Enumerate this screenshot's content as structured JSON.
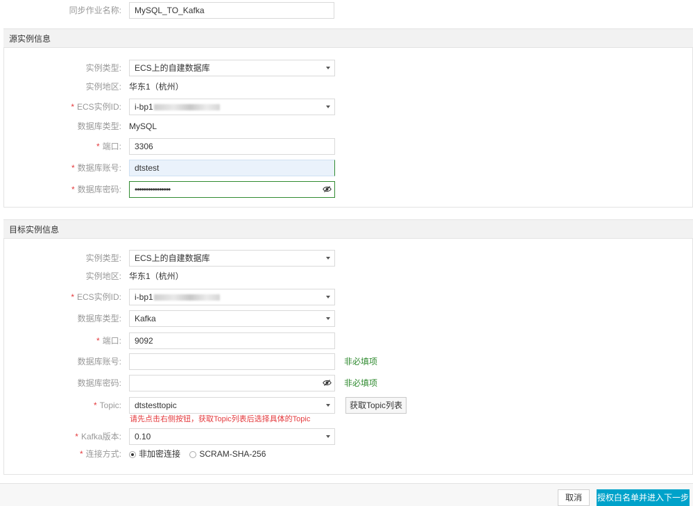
{
  "top": {
    "job_name_label": "同步作业名称:",
    "job_name_value": "MySQL_TO_Kafka"
  },
  "source": {
    "header": "源实例信息",
    "instance_type_label": "实例类型:",
    "instance_type_value": "ECS上的自建数据库",
    "region_label": "实例地区:",
    "region_value": "华东1（杭州）",
    "ecs_id_label": "ECS实例ID:",
    "ecs_id_value": "i-bp1",
    "db_type_label": "数据库类型:",
    "db_type_value": "MySQL",
    "port_label": "端口:",
    "port_value": "3306",
    "account_label": "数据库账号:",
    "account_value": "dtstest",
    "password_label": "数据库密码:",
    "password_value": "••••••••••••••••"
  },
  "target": {
    "header": "目标实例信息",
    "instance_type_label": "实例类型:",
    "instance_type_value": "ECS上的自建数据库",
    "region_label": "实例地区:",
    "region_value": "华东1（杭州）",
    "ecs_id_label": "ECS实例ID:",
    "ecs_id_value": "i-bp1",
    "db_type_label": "数据库类型:",
    "db_type_value": "Kafka",
    "port_label": "端口:",
    "port_value": "9092",
    "account_label": "数据库账号:",
    "account_value": "",
    "account_hint": "非必填项",
    "password_label": "数据库密码:",
    "password_value": "",
    "password_hint": "非必填项",
    "topic_label": "Topic:",
    "topic_value": "dtstesttopic",
    "topic_button": "获取Topic列表",
    "topic_note": "请先点击右侧按钮，获取Topic列表后选择具体的Topic",
    "kafka_version_label": "Kafka版本:",
    "kafka_version_value": "0.10",
    "connection_label": "连接方式:",
    "connection_options": [
      "非加密连接",
      "SCRAM-SHA-256"
    ],
    "connection_selected": "非加密连接"
  },
  "footer": {
    "cancel_label": "取消",
    "next_label": "授权白名单并进入下一步"
  },
  "colors": {
    "primary": "#00a2ca",
    "required": "#e4393c",
    "hint": "#2f8a2f",
    "focus_border": "#2f8a2f",
    "error_text": "#e4393c"
  }
}
